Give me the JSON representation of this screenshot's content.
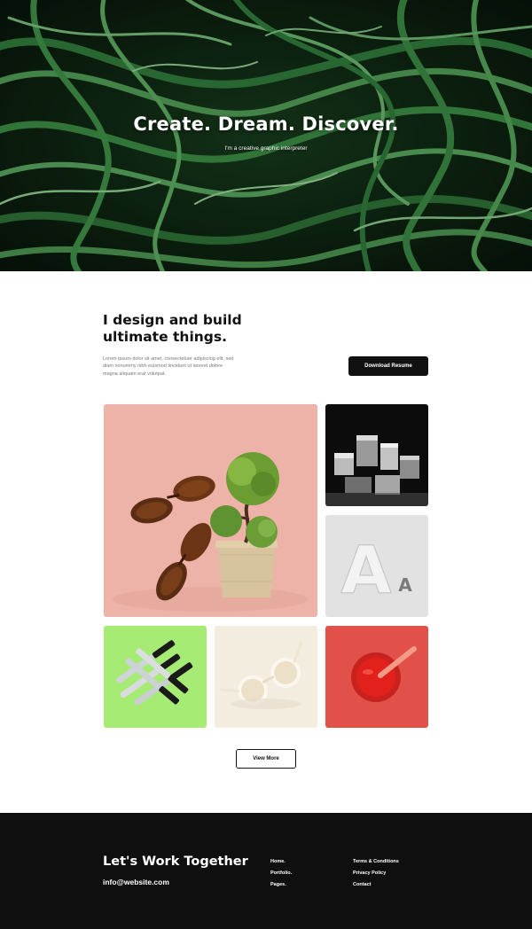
{
  "hero": {
    "title": "Create. Dream. Discover.",
    "subtitle": "I'm a creative graphic interpreter"
  },
  "intro": {
    "heading_line1": "I design and build",
    "heading_line2": "ultimate things.",
    "body": "Lorem ipsum dolor sit amet, consectetuer adipiscing elit, sed diam nonummy nibh euismod tincidunt ut laoreet dolore magna aliquam erat volutpat.",
    "download_button": "Download Resume"
  },
  "gallery": {
    "view_more_button": "View More"
  },
  "footer": {
    "title": "Let's Work Together",
    "email": "info@website.com",
    "nav_col1": [
      "Home.",
      "Portfolio.",
      "Pages."
    ],
    "nav_col2": [
      "Terms & Conditions",
      "Privacy Policy",
      "Contact"
    ]
  },
  "colors": {
    "hero_bg": "#0b1a0e",
    "leaf_green": "#3e8a45",
    "tile_pink": "#edb3a8",
    "tile_lime": "#a6ec74",
    "tile_red": "#e2504a",
    "footer_bg": "#0f0f0f",
    "button_dark": "#111111"
  }
}
